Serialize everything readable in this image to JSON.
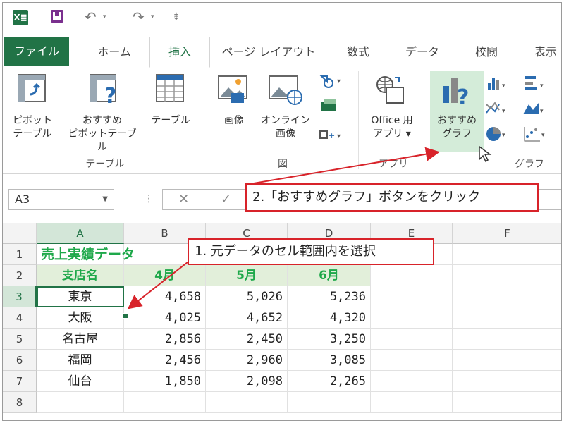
{
  "qat": {
    "logo": "X≣",
    "undo_glyph": "↶",
    "redo_glyph": "↷",
    "customize_glyph": "⇟"
  },
  "tabs": [
    "ファイル",
    "ホーム",
    "挿入",
    "ページ レイアウト",
    "数式",
    "データ",
    "校閲",
    "表示"
  ],
  "ribbon": {
    "pivot": [
      "ピボット",
      "テーブル"
    ],
    "recommended_pivot": [
      "おすすめ",
      "ピボットテーブル"
    ],
    "table": "テーブル",
    "group_table": "テーブル",
    "image": "画像",
    "online_image": [
      "オンライン",
      "画像"
    ],
    "group_illustration": "図",
    "office_app": [
      "Office 用",
      "アプリ ▾"
    ],
    "group_app": "アプリ",
    "recommended_chart": [
      "おすすめ",
      "グラフ"
    ],
    "group_chart": "グラフ"
  },
  "formula_bar": {
    "namebox": "A3",
    "cancel": "✕",
    "enter": "✓"
  },
  "grid": {
    "columns": [
      "A",
      "B",
      "C",
      "D",
      "E",
      "F"
    ],
    "rows": [
      "1",
      "2",
      "3",
      "4",
      "5",
      "6",
      "7",
      "8"
    ],
    "title": "売上実績データ",
    "headers": [
      "支店名",
      "4月",
      "5月",
      "6月"
    ],
    "data": [
      [
        "東京",
        "4,658",
        "5,026",
        "5,236"
      ],
      [
        "大阪",
        "4,025",
        "4,652",
        "4,320"
      ],
      [
        "名古屋",
        "2,856",
        "2,450",
        "3,250"
      ],
      [
        "福岡",
        "2,456",
        "2,960",
        "3,085"
      ],
      [
        "仙台",
        "1,850",
        "2,098",
        "2,265"
      ]
    ]
  },
  "callouts": {
    "step1": "1. 元データのセル範囲内を選択",
    "step2": "2.「おすすめグラフ」ボタンをクリック"
  },
  "colors": {
    "excel_green": "#217346",
    "callout_red": "#d8232a",
    "header_fill": "#e2efda",
    "title_green": "#1ea84a"
  }
}
